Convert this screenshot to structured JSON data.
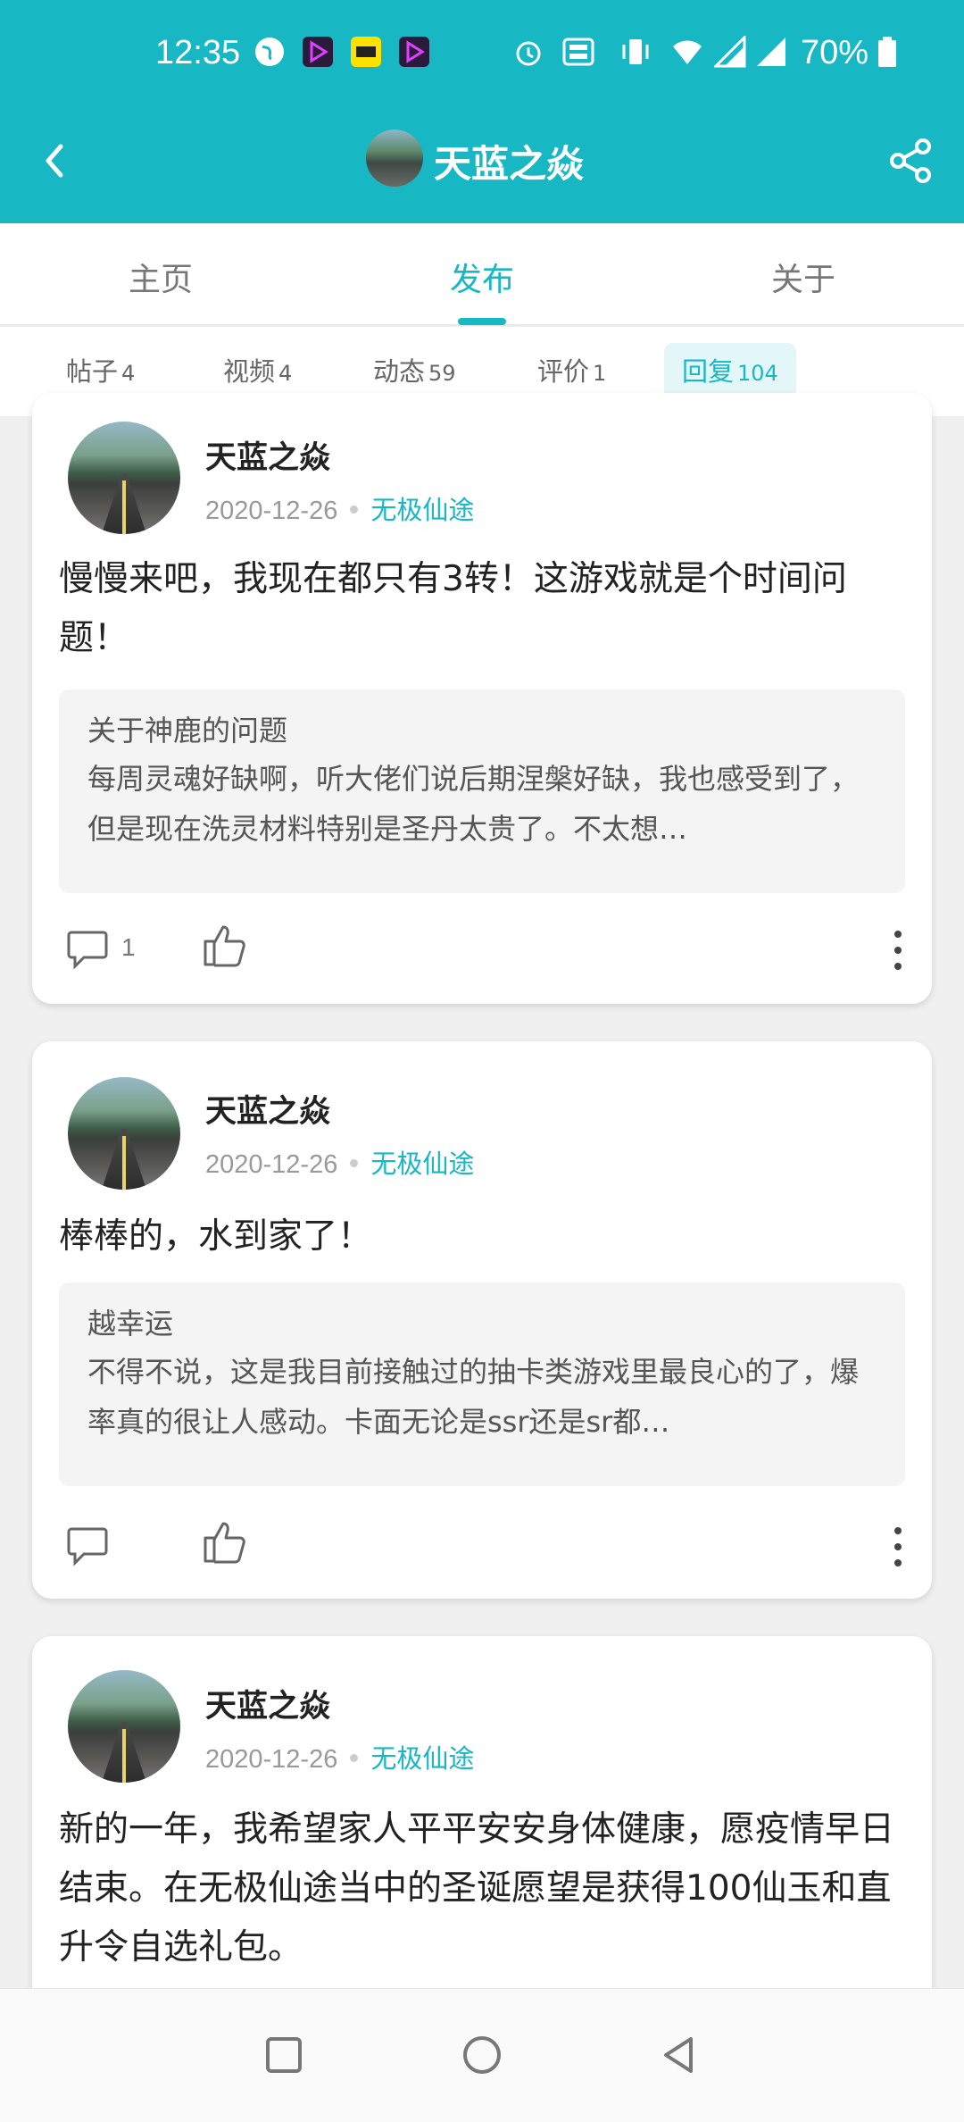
{
  "status": {
    "time": "12:35",
    "battery": "70%"
  },
  "header": {
    "title": "天蓝之焱"
  },
  "tabs": [
    {
      "label": "主页"
    },
    {
      "label": "发布"
    },
    {
      "label": "关于"
    }
  ],
  "filters": [
    {
      "label": "帖子",
      "count": "4"
    },
    {
      "label": "视频",
      "count": "4"
    },
    {
      "label": "动态",
      "count": "59"
    },
    {
      "label": "评价",
      "count": "1"
    },
    {
      "label": "回复",
      "count": "104"
    }
  ],
  "posts": [
    {
      "author": "天蓝之焱",
      "date": "2020-12-26",
      "game": "无极仙途",
      "content": "慢慢来吧，我现在都只有3转！这游戏就是个时间问题！",
      "quote_title": "关于神鹿的问题",
      "quote_body": "每周灵魂好缺啊，听大佬们说后期涅槃好缺，我也感受到了，但是现在洗灵材料特别是圣丹太贵了。不太想…",
      "comment_count": "1"
    },
    {
      "author": "天蓝之焱",
      "date": "2020-12-26",
      "game": "无极仙途",
      "content": "棒棒的，水到家了！",
      "quote_title": "越幸运",
      "quote_body": "不得不说，这是我目前接触过的抽卡类游戏里最良心的了，爆率真的很让人感动。卡面无论是ssr还是sr都…",
      "comment_count": ""
    },
    {
      "author": "天蓝之焱",
      "date": "2020-12-26",
      "game": "无极仙途",
      "content": "新的一年，我希望家人平平安安身体健康，愿疫情早日结束。在无极仙途当中的圣诞愿望是获得100仙玉和直升令自选礼包。"
    }
  ],
  "colors": {
    "accent": "#17b7c4",
    "background": "#f0f0f0"
  }
}
